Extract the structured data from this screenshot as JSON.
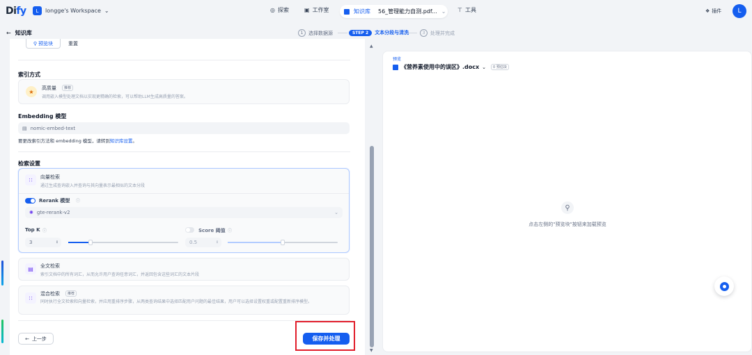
{
  "header": {
    "logo_prefix": "Di",
    "logo_suffix": "fy",
    "workspace_badge": "L",
    "workspace": "longge's Workspace",
    "nav": {
      "explore": "探索",
      "studio": "工作室",
      "knowledge": "知识库",
      "current_doc": "56_管理能力自测.pdf...",
      "tools": "工具"
    },
    "plugins": "插件",
    "avatar": "L"
  },
  "subheader": {
    "back_label": "知识库",
    "steps": [
      {
        "num": "1",
        "label": "选择数据源"
      },
      {
        "pill": "STEP 2",
        "label": "文本分段与清洗"
      },
      {
        "num": "3",
        "label": "处理并完成"
      }
    ]
  },
  "form": {
    "top_buttons": [
      "预览块",
      "重置"
    ],
    "index_section": "索引方式",
    "high_quality": {
      "title": "高质量",
      "tag": "推荐",
      "desc": "调用嵌入模型处理文档以实现更精确的检索，可以帮助LLM生成高质量的答案。"
    },
    "embedding_section": "Embedding 模型",
    "embedding_model": "nomic-embed-text",
    "embedding_hint": "要更改索引方法和 embedding 模型，请转到",
    "embedding_link": "知识库设置",
    "embedding_hint_end": "。",
    "retrieval_section": "检索设置",
    "vector": {
      "title": "向量检索",
      "desc": "通过生成查询嵌入并查询与其向量表示最相似的文本分段"
    },
    "rerank": {
      "label": "Rerank 模型",
      "enabled": true,
      "model": "gte-rerank-v2"
    },
    "topk": {
      "label": "Top K",
      "value": "3",
      "fraction": 0.2
    },
    "score": {
      "label": "Score 阈值",
      "enabled": false,
      "value": "0.5",
      "fraction": 0.5
    },
    "fulltext": {
      "title": "全文检索",
      "desc": "索引文档中的所有词汇，从而允许用户查询任意词汇，并返回包含这些词汇的文本片段"
    },
    "hybrid": {
      "title": "混合检索",
      "tag": "推荐",
      "desc": "同时执行全文检索和向量检索，并应用重排序步骤，从两类查询结果中选择匹配用户问题的最佳结果，用户可以选择设置权重或配置重新排序模型。"
    },
    "prev_button": "上一步",
    "save_button": "保存并处理"
  },
  "preview": {
    "label": "预览",
    "doc_name": "《营养素使用中的误区》.docx",
    "chunks": "0 预估块",
    "empty": "点击左侧的\"预览块\"按钮来加载预览"
  },
  "colors": {
    "accent": "#155eef",
    "highlight_box": "#e11d2a"
  }
}
